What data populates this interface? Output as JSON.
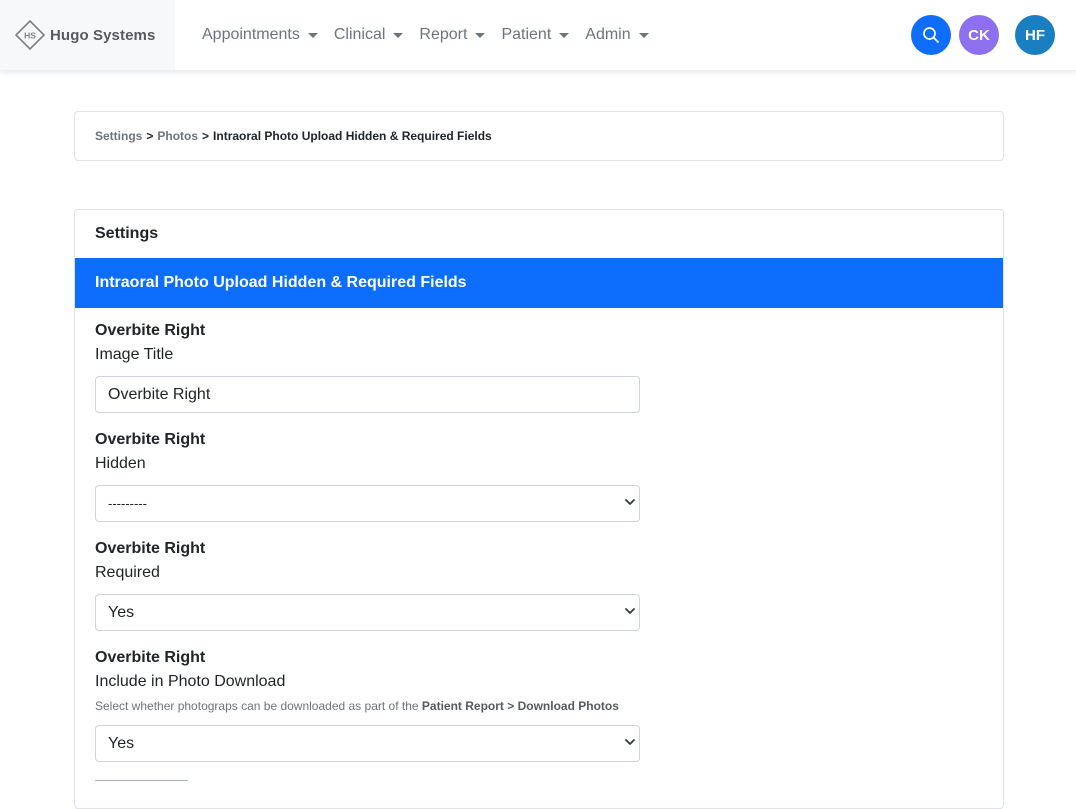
{
  "brand": {
    "logo_text": "HS",
    "name": "Hugo Systems"
  },
  "nav": {
    "items": [
      {
        "label": "Appointments"
      },
      {
        "label": "Clinical"
      },
      {
        "label": "Report"
      },
      {
        "label": "Patient"
      },
      {
        "label": "Admin"
      }
    ]
  },
  "user_menu": {
    "avatar_1": "CK",
    "avatar_2": "HF"
  },
  "colors": {
    "primary": "#0d6efd",
    "avatar_ck": "#8e6ff0",
    "avatar_hf": "#1a7fc1"
  },
  "breadcrumb": {
    "items": [
      "Settings",
      "Photos"
    ],
    "separator": ">",
    "current": "Intraoral Photo Upload Hidden & Required Fields"
  },
  "card": {
    "header": "Settings",
    "banner": "Intraoral Photo Upload Hidden & Required Fields",
    "fields": [
      {
        "title": "Overbite Right",
        "label": "Image Title",
        "type": "text",
        "value": "Overbite Right"
      },
      {
        "title": "Overbite Right",
        "label": "Hidden",
        "type": "select",
        "value": "---------"
      },
      {
        "title": "Overbite Right",
        "label": "Required",
        "type": "select",
        "value": "Yes"
      },
      {
        "title": "Overbite Right",
        "label": "Include in Photo Download",
        "type": "select",
        "value": "Yes",
        "help_prefix": "Select whether photograps can be downloaded as part of the ",
        "help_bold": "Patient Report > Download Photos"
      }
    ]
  }
}
